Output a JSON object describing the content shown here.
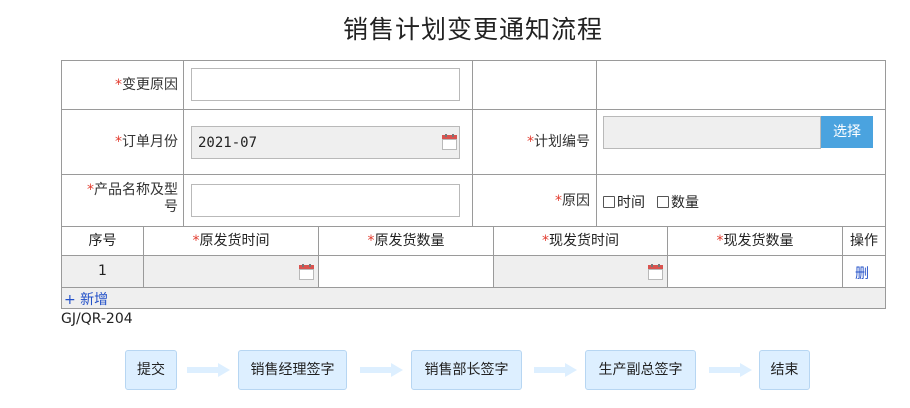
{
  "page": {
    "title": "销售计划变更通知流程"
  },
  "form": {
    "required_mark": "*",
    "change_reason": {
      "label": "变更原因",
      "value": ""
    },
    "order_month": {
      "label": "订单月份",
      "value": "2021-07"
    },
    "plan_number": {
      "label": "计划编号",
      "value": "",
      "button": "选择"
    },
    "product_name": {
      "label_line1": "产品名称及型",
      "label_line2": "号",
      "value": ""
    },
    "reason": {
      "label": "原因",
      "options": [
        "时间",
        "数量"
      ]
    }
  },
  "detail_table": {
    "headers": {
      "seq": "序号",
      "orig_time": "原发货时间",
      "orig_qty": "原发货数量",
      "new_time": "现发货时间",
      "new_qty": "现发货数量",
      "action": "操作"
    },
    "rows": [
      {
        "seq": "1",
        "orig_time": "",
        "orig_qty": "",
        "new_time": "",
        "new_qty": "",
        "action": "删"
      }
    ],
    "add_label": "+ 新增"
  },
  "doc_code": "GJ/QR-204",
  "flow": {
    "steps": [
      "提交",
      "销售经理签字",
      "销售部长签字",
      "生产副总签字",
      "结束"
    ]
  },
  "colors": {
    "required": "#e23b2e",
    "button": "#4aa3df",
    "link": "#2250c8",
    "flow_box": "#ddefff",
    "readonly_bg": "#efefef"
  },
  "icons": {
    "date_picker": "calendar-icon",
    "flow_connector": "arrow-right-icon"
  }
}
